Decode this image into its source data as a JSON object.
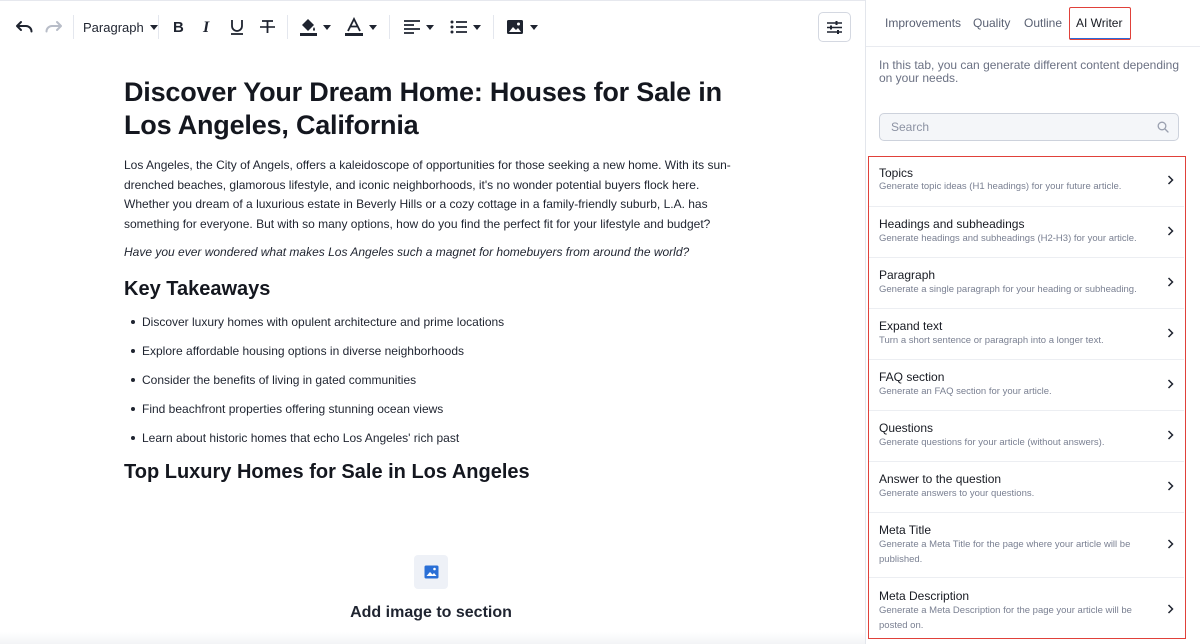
{
  "toolbar": {
    "paragraph_label": "Paragraph"
  },
  "document": {
    "title": "Discover Your Dream Home: Houses for Sale in Los Angeles, California",
    "intro": "Los Angeles, the City of Angels, offers a kaleidoscope of opportunities for those seeking a new home. With its sun-drenched beaches, glamorous lifestyle, and iconic neighborhoods, it's no wonder potential buyers flock here. Whether you dream of a luxurious estate in Beverly Hills or a cozy cottage in a family-friendly suburb, L.A. has something for everyone. But with so many options, how do you find the perfect fit for your lifestyle and budget?",
    "question": "Have you ever wondered what makes Los Angeles such a magnet for homebuyers from around the world?",
    "key_takeaways_heading": "Key Takeaways",
    "key_takeaways": [
      "Discover luxury homes with opulent architecture and prime locations",
      "Explore affordable housing options in diverse neighborhoods",
      "Consider the benefits of living in gated communities",
      "Find beachfront properties offering stunning ocean views",
      "Learn about historic homes that echo Los Angeles' rich past"
    ],
    "section_heading": "Top Luxury Homes for Sale in Los Angeles",
    "add_image_label": "Add image to section"
  },
  "panel": {
    "tabs": [
      "Improvements",
      "Quality",
      "Outline",
      "AI Writer"
    ],
    "active_tab": "AI Writer",
    "description": "In this tab, you can generate different content depending on your needs.",
    "search_placeholder": "Search",
    "items": [
      {
        "title": "Topics",
        "desc": "Generate topic ideas (H1 headings) for your future article."
      },
      {
        "title": "Headings and subheadings",
        "desc": "Generate headings and subheadings (H2-H3) for your article."
      },
      {
        "title": "Paragraph",
        "desc": "Generate a single paragraph for your heading or subheading."
      },
      {
        "title": "Expand text",
        "desc": "Turn a short sentence or paragraph into a longer text."
      },
      {
        "title": "FAQ section",
        "desc": "Generate an FAQ section for your article."
      },
      {
        "title": "Questions",
        "desc": "Generate questions for your article (without answers)."
      },
      {
        "title": "Answer to the question",
        "desc": "Generate answers to your questions."
      },
      {
        "title": "Meta Title",
        "desc": "Generate a Meta Title for the page where your article will be published."
      },
      {
        "title": "Meta Description",
        "desc": "Generate a Meta Description for the page your article will be posted on."
      }
    ]
  },
  "colors": {
    "highlight_border": "#e0413a",
    "active_tab_underline": "#2b6ad8",
    "image_icon": "#2a6fd6"
  }
}
